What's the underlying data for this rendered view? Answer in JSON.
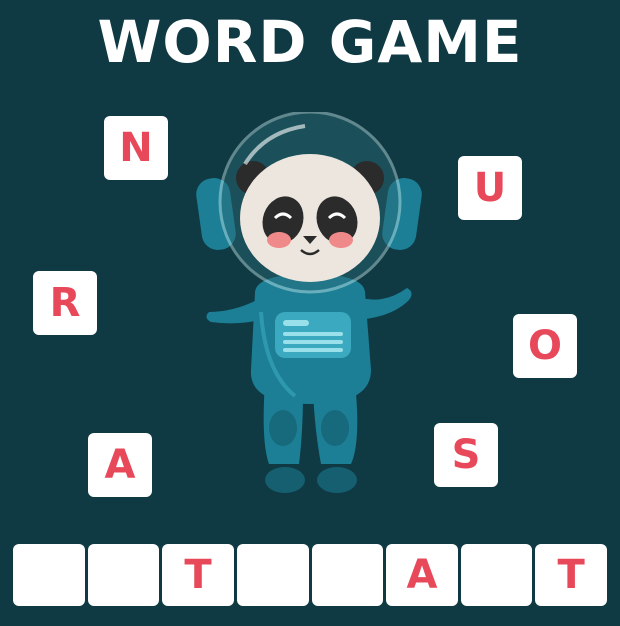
{
  "title": "WORD GAME",
  "colors": {
    "background": "#0f3a43",
    "tile": "#ffffff",
    "letter": "#e8495a",
    "suit": "#1c7f96"
  },
  "scattered_letters": [
    "N",
    "U",
    "R",
    "O",
    "A",
    "S"
  ],
  "answer_slots": [
    "",
    "",
    "T",
    "",
    "",
    "A",
    "",
    "T"
  ],
  "character": "astronaut-panda"
}
